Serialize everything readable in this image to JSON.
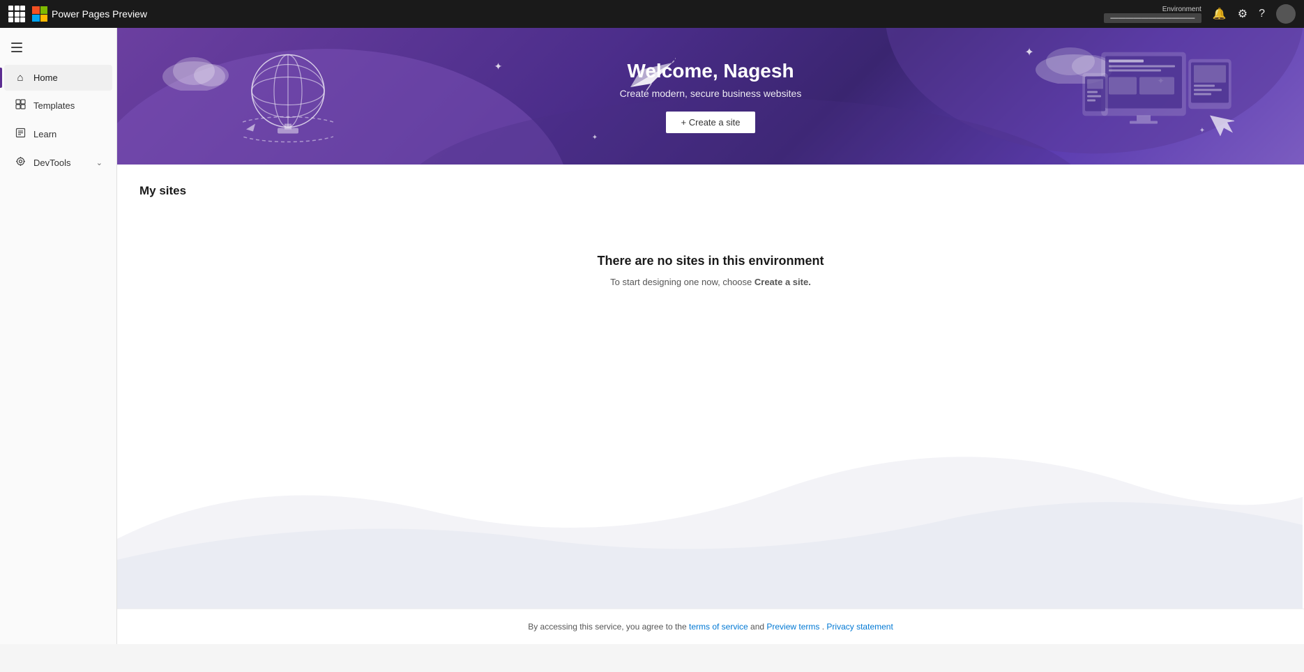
{
  "topbar": {
    "title": "Power Pages Preview",
    "environment_label": "Environment",
    "environment_name": "———————————",
    "icons": {
      "waffle": "waffle-icon",
      "notification": "🔔",
      "settings": "⚙",
      "help": "?",
      "avatar": "avatar-icon"
    }
  },
  "sidebar": {
    "hamburger_label": "menu",
    "items": [
      {
        "id": "home",
        "label": "Home",
        "icon": "⌂",
        "active": true
      },
      {
        "id": "templates",
        "label": "Templates",
        "icon": "☰",
        "active": false
      },
      {
        "id": "learn",
        "label": "Learn",
        "icon": "□",
        "active": false
      },
      {
        "id": "devtools",
        "label": "DevTools",
        "icon": "◈",
        "active": false,
        "expandable": true
      }
    ]
  },
  "hero": {
    "welcome_text": "Welcome, Nagesh",
    "subtitle": "Create modern, secure business websites",
    "create_btn_label": "+ Create a site"
  },
  "main": {
    "my_sites_title": "My sites",
    "empty_state_title": "There are no sites in this environment",
    "empty_state_desc_prefix": "To start designing one now, choose ",
    "empty_state_desc_link": "Create a site.",
    "empty_state_desc_suffix": ""
  },
  "footer": {
    "prefix": "By accessing this service, you agree to the ",
    "tos_label": "terms of service",
    "tos_url": "#",
    "and": " and ",
    "preview_label": "Preview terms",
    "preview_url": "#",
    "period": ".",
    "privacy_label": "Privacy statement",
    "privacy_url": "#"
  }
}
